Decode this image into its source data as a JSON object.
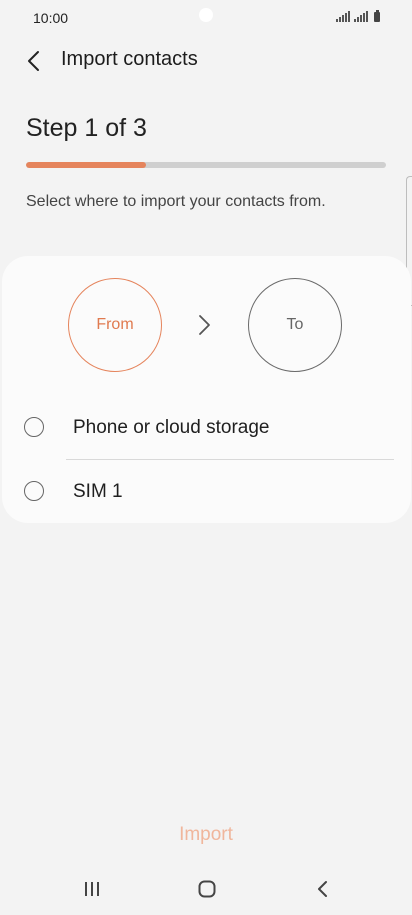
{
  "status_bar": {
    "time": "10:00",
    "icons": [
      "signal-icon",
      "signal-icon",
      "battery-icon"
    ]
  },
  "header": {
    "back_icon": "chevron-left-icon",
    "title": "Import contacts"
  },
  "step": {
    "title": "Step 1 of 3",
    "progress_fraction": 0.333
  },
  "instruction": "Select where to import your contacts from.",
  "flow": {
    "from_label": "From",
    "to_label": "To",
    "arrow_icon": "chevron-right-icon"
  },
  "options": [
    {
      "label": "Phone or cloud storage",
      "selected": false
    },
    {
      "label": "SIM 1",
      "selected": false
    }
  ],
  "import_button": {
    "label": "Import",
    "enabled": false
  },
  "nav_bar": {
    "icons": [
      "recent-apps-icon",
      "home-icon",
      "back-icon"
    ]
  },
  "colors": {
    "accent": "#e5845c",
    "accent_disabled": "#f0b69c",
    "background": "#f3f3f3",
    "card": "#fbfbfb"
  }
}
